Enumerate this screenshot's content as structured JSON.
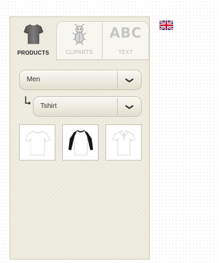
{
  "tabs": [
    {
      "label": "PRODUCTS",
      "icon": "tshirt-icon",
      "active": true
    },
    {
      "label": "CLIPARTS",
      "icon": "clipart-bug-icon",
      "active": false
    },
    {
      "label": "TEXT",
      "icon": "abc-icon",
      "active": false
    }
  ],
  "text_tab_icon_text": "ABC",
  "gender_select": {
    "value": "Men"
  },
  "type_select": {
    "value": "Tshirt"
  },
  "products": [
    {
      "name": "white-tshirt",
      "color": "#ffffff"
    },
    {
      "name": "raglan-black-sleeves",
      "color": "#1a1a1a"
    },
    {
      "name": "white-polo",
      "color": "#ffffff"
    }
  ],
  "language": {
    "flag": "uk-flag-icon"
  },
  "colors": {
    "panel_bg": "#eeebdf",
    "tab_active_text": "#222222",
    "tab_inactive_text": "#b8b8b8"
  }
}
